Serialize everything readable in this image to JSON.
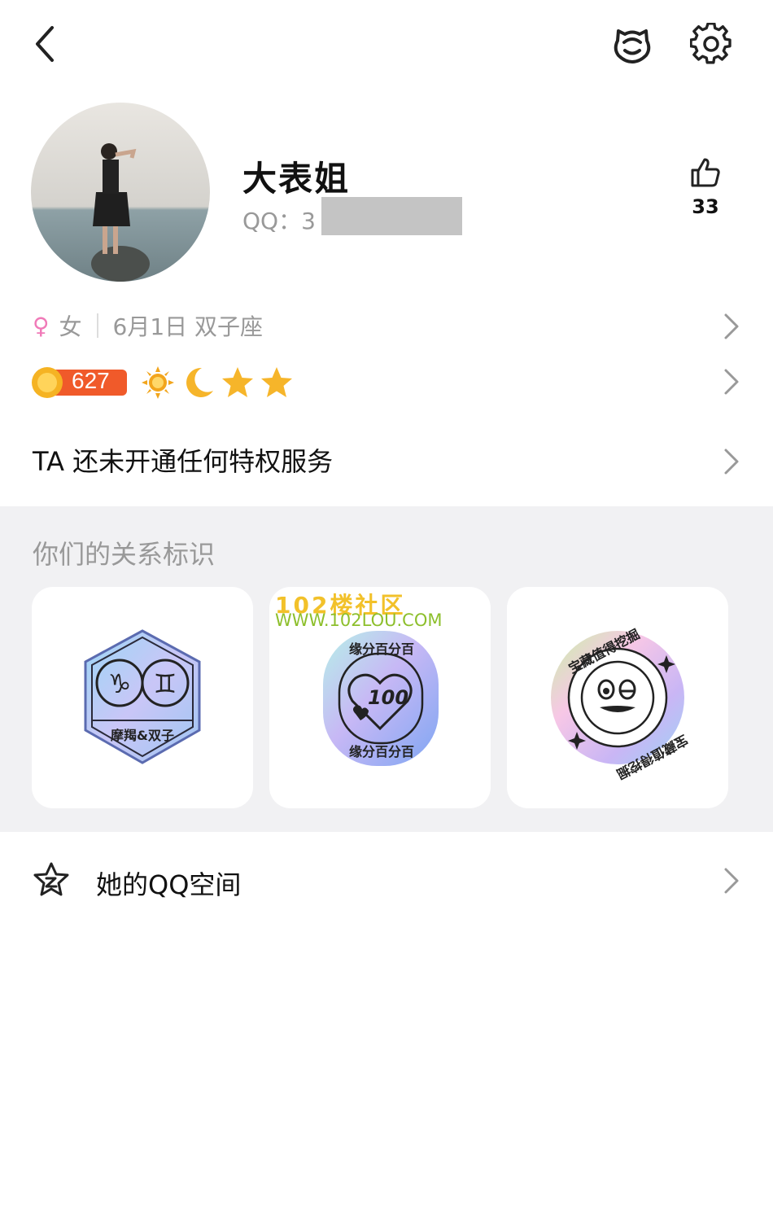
{
  "topbar": {
    "back_icon": "chevron-left-icon",
    "pet_icon": "pet-face-icon",
    "settings_icon": "gear-icon"
  },
  "profile": {
    "nickname": "大表姐",
    "qq_label": "QQ：3",
    "likes_count": "33"
  },
  "info": {
    "gender_symbol": "♀",
    "gender": "女",
    "birthday_sign": "6月1日 双子座"
  },
  "level": {
    "points": "627",
    "icons": [
      "sun-icon",
      "moon-icon",
      "star-icon",
      "star-icon"
    ]
  },
  "privilege": {
    "text": "TA 还未开通任何特权服务"
  },
  "relationship": {
    "title": "你们的关系标识",
    "badges": [
      {
        "label": "摩羯&双子",
        "symbols": "♑♊"
      },
      {
        "label": "100",
        "ring_text": "缘分百分百"
      },
      {
        "ring_text": "宝藏值得挖掘"
      }
    ],
    "watermark_line1": "102楼社区",
    "watermark_line2": "WWW.102LOU.COM"
  },
  "zone": {
    "label": "她的QQ空间"
  },
  "colors": {
    "accent_pink": "#f07ab8",
    "level_red": "#f05a2a",
    "coin_gold": "#f5b323",
    "section_bg": "#f1f1f3"
  }
}
